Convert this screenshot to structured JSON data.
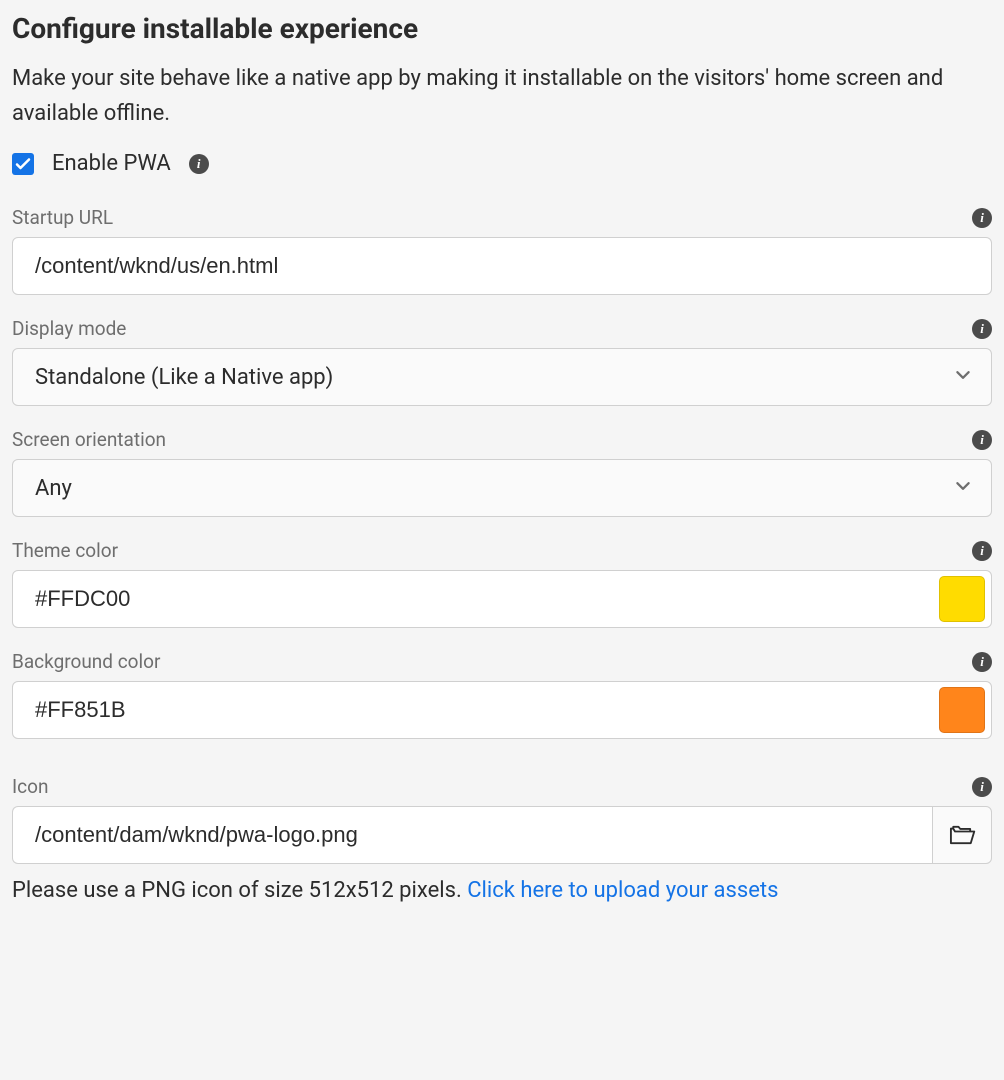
{
  "header": {
    "title": "Configure installable experience",
    "description": "Make your site behave like a native app by making it installable on the visitors' home screen and available offline."
  },
  "enable": {
    "label": "Enable PWA",
    "checked": true
  },
  "fields": {
    "startup_url": {
      "label": "Startup URL",
      "value": "/content/wknd/us/en.html"
    },
    "display_mode": {
      "label": "Display mode",
      "value": "Standalone (Like a Native app)"
    },
    "screen_orientation": {
      "label": "Screen orientation",
      "value": "Any"
    },
    "theme_color": {
      "label": "Theme color",
      "value": "#FFDC00",
      "swatch": "#FFDC00"
    },
    "background_color": {
      "label": "Background color",
      "value": "#FF851B",
      "swatch": "#FF851B"
    },
    "icon": {
      "label": "Icon",
      "value": "/content/dam/wknd/pwa-logo.png",
      "hint_prefix": "Please use a PNG icon of size 512x512 pixels. ",
      "hint_link": "Click here to upload your assets"
    }
  }
}
